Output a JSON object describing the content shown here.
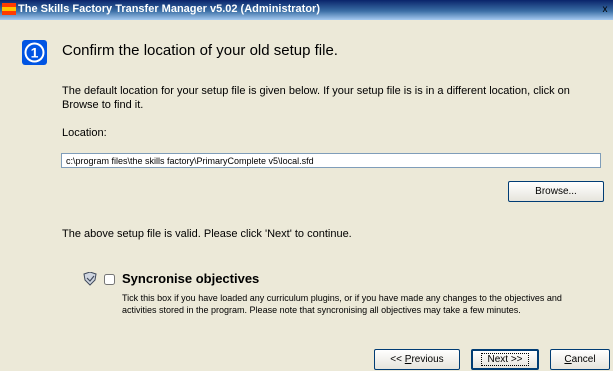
{
  "window": {
    "title": "The Skills Factory Transfer Manager v5.02 (Administrator)",
    "close_label": "x"
  },
  "step": {
    "number": "1",
    "heading": "Confirm the location of your old setup file.",
    "description": "The default location for your setup file is given below. If your setup file is is in a different location, click on Browse to find it."
  },
  "location": {
    "label": "Location:",
    "value": "c:\\program files\\the skills factory\\PrimaryComplete v5\\local.sfd"
  },
  "browse_label": "Browse...",
  "valid_message": "The above setup file is valid. Please click 'Next' to continue.",
  "sync": {
    "label": "Syncronise objectives",
    "checked": false,
    "description": "Tick this box if you have loaded any curriculum plugins, or if you have made any changes to the objectives and activities stored in the program. Please note that syncronising all objectives may take a few minutes."
  },
  "buttons": {
    "previous_prefix": "<< ",
    "previous_underlined": "P",
    "previous_rest": "revious",
    "next": "Next >>",
    "cancel_underlined": "C",
    "cancel_rest": "ancel"
  },
  "colors": {
    "titlebar": "#0a246a",
    "badge": "#0054e3",
    "dialog_bg": "#ece9d8"
  }
}
